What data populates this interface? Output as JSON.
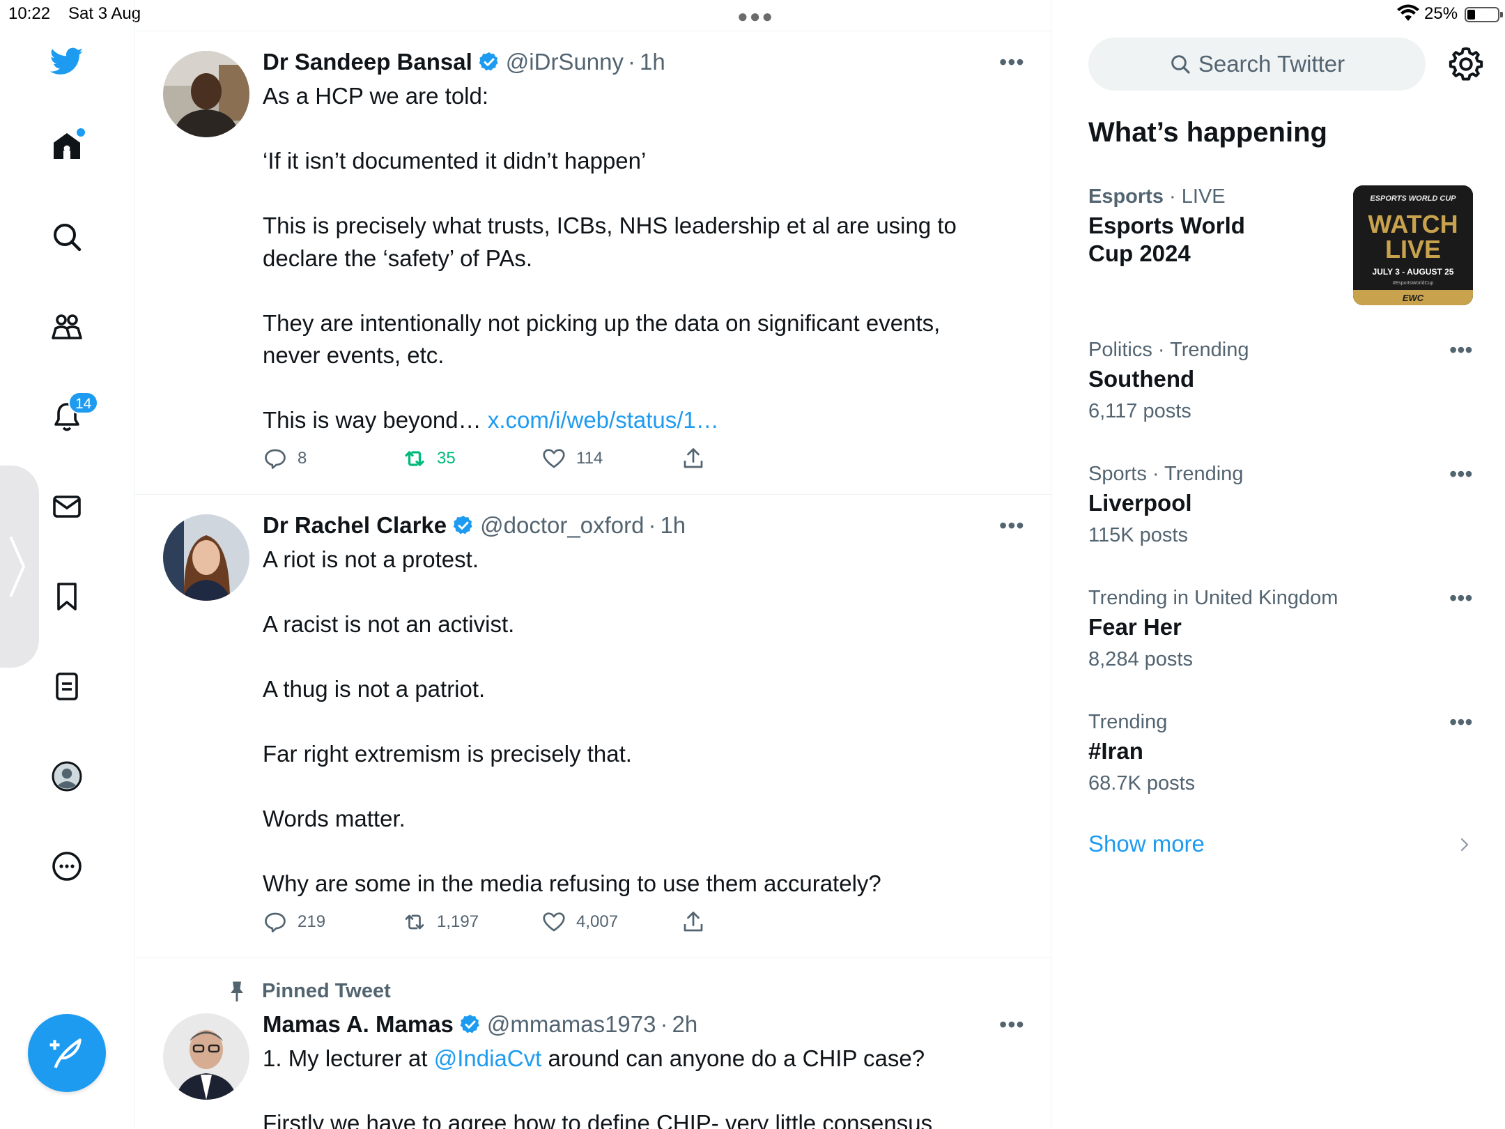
{
  "status": {
    "time": "10:22",
    "date": "Sat 3 Aug",
    "battery_pct": "25%",
    "battery_level": 0.25
  },
  "nav": {
    "notifications_badge": "14",
    "items": [
      "home-icon",
      "explore-icon",
      "communities-icon",
      "notifications-icon",
      "messages-icon",
      "bookmarks-icon",
      "lists-icon",
      "profile-icon",
      "more-icon"
    ]
  },
  "colors": {
    "accent": "#1d9bf0",
    "retweeted": "#00ba7c",
    "secondary_text": "#536471"
  },
  "tweets": [
    {
      "name": "Dr Sandeep Bansal",
      "handle": "@iDrSunny",
      "time": "1h",
      "body_lines": [
        "As a HCP we are told:",
        "",
        "‘If it isn’t documented it didn’t happen’",
        "",
        "This is precisely what trusts, ICBs, NHS leadership et al are using to declare the ‘safety’ of PAs.",
        "",
        "They are intentionally not picking up the data on significant events, never events, etc.",
        ""
      ],
      "body_last": "This is way beyond… ",
      "link": "x.com/i/web/status/1…",
      "replies": "8",
      "retweets": "35",
      "likes": "114"
    },
    {
      "name": "Dr Rachel Clarke",
      "handle": "@doctor_oxford",
      "time": "1h",
      "body": "A riot is not a protest.\n\nA racist is not an activist.\n\nA thug is not a patriot.\n\nFar right extremism is precisely that.\n\nWords matter.\n\nWhy are some in the media refusing to use them accurately?",
      "replies": "219",
      "retweets": "1,197",
      "likes": "4,007"
    },
    {
      "pinned_label": "Pinned Tweet",
      "name": "Mamas A. Mamas",
      "handle": "@mmamas1973",
      "time": "2h",
      "body_pre": "1. My lecturer at ",
      "mention": "@IndiaCvt",
      "body_post": " around can anyone do a CHIP case?",
      "body_next": "Firstly we have to agree how to define CHIP- very little consensus"
    }
  ],
  "right": {
    "search_placeholder": "Search Twitter",
    "section_title": "What’s happening",
    "featured": {
      "category": "Esports",
      "live": "LIVE",
      "title": "Esports World Cup 2024",
      "image_text": {
        "brand": "ESPORTS WORLD CUP",
        "watch": "WATCH",
        "live": "LIVE",
        "dates": "JULY 3 - AUGUST 25",
        "hashtag": "#EsportsWorldCup",
        "banner": "EWC"
      }
    },
    "trends": [
      {
        "meta": "Politics · Trending",
        "title": "Southend",
        "count": "6,117 posts"
      },
      {
        "meta": "Sports · Trending",
        "title": "Liverpool",
        "count": "115K posts"
      },
      {
        "meta": "Trending in United Kingdom",
        "title": "Fear Her",
        "count": "8,284 posts"
      },
      {
        "meta": "Trending",
        "title": "#Iran",
        "count": "68.7K posts"
      }
    ],
    "show_more": "Show more"
  }
}
